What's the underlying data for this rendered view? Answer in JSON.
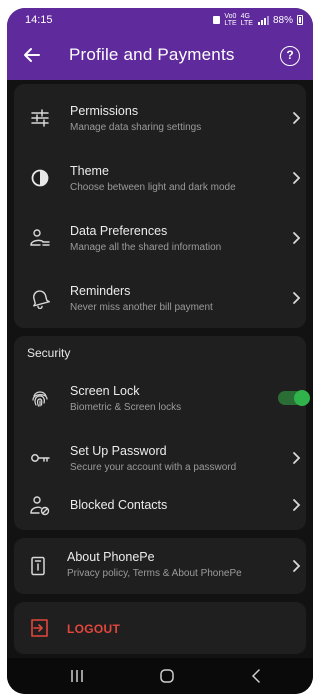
{
  "status_bar": {
    "time": "14:15",
    "network_top": "Vo0",
    "network_bottom": "LTE",
    "signal_top": "4G",
    "signal_bottom": "LTE",
    "battery": "88%"
  },
  "app_bar": {
    "title": "Profile and Payments",
    "back_icon": "arrow-left-icon",
    "help_icon": "question-circle-icon",
    "help_glyph": "?"
  },
  "settings_group": {
    "items": [
      {
        "title": "Permissions",
        "subtitle": "Manage data sharing settings",
        "icon": "sliders-icon"
      },
      {
        "title": "Theme",
        "subtitle": "Choose between light and dark mode",
        "icon": "half-circle-icon"
      },
      {
        "title": "Data Preferences",
        "subtitle": "Manage all the shared information",
        "icon": "user-list-icon"
      },
      {
        "title": "Reminders",
        "subtitle": "Never miss another bill payment",
        "icon": "bell-icon"
      }
    ]
  },
  "security": {
    "heading": "Security",
    "items": [
      {
        "title": "Screen Lock",
        "subtitle": "Biometric & Screen locks",
        "icon": "fingerprint-icon",
        "toggle_on": true
      },
      {
        "title": "Set Up Password",
        "subtitle": "Secure your account with a password",
        "icon": "key-icon"
      },
      {
        "title": "Blocked Contacts",
        "subtitle": "",
        "icon": "user-blocked-icon"
      }
    ]
  },
  "about": {
    "title": "About PhonePe",
    "subtitle": "Privacy policy, Terms & About PhonePe",
    "icon": "info-device-icon"
  },
  "logout": {
    "label": "LOGOUT",
    "icon": "logout-icon",
    "color": "#e2463c"
  },
  "nav_bar": {
    "recents_icon": "recents-icon",
    "home_icon": "home-icon",
    "back_icon": "nav-back-icon"
  },
  "colors": {
    "brand": "#5f2a9c",
    "background": "#121212",
    "card": "#1f1f1f",
    "toggle": "#2fb34a"
  }
}
